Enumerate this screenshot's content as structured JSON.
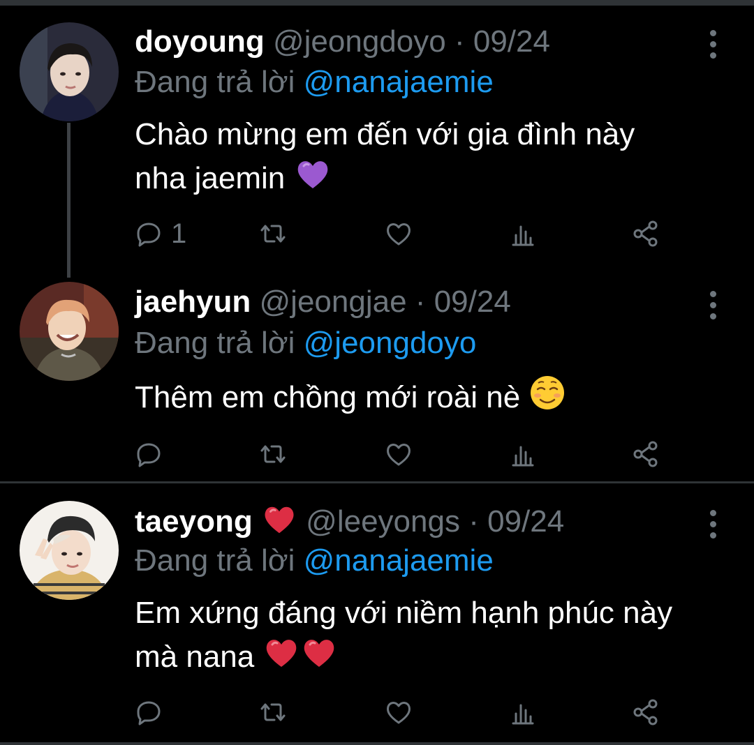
{
  "icons": {
    "reply": "reply-icon",
    "retweet": "retweet-icon",
    "like": "heart-icon",
    "analytics": "analytics-icon",
    "share": "share-icon",
    "more": "more-vertical-icon"
  },
  "colors": {
    "background": "#000000",
    "secondary_text": "#6e767d",
    "mention": "#1d9bf0",
    "divider": "#2f3336"
  },
  "tweets": [
    {
      "name": "doyoung",
      "handle": "@jeongdoyo",
      "separator": "·",
      "date": "09/24",
      "reply_label": "Đang trả lời",
      "reply_to": "@nanajaemie",
      "text_line1": "Chào mừng em đến với gia đình này",
      "text_line2": "nha jaemin",
      "emoji": "purple-heart",
      "reply_count": "1"
    },
    {
      "name": "jaehyun",
      "handle": "@jeongjae",
      "separator": "·",
      "date": "09/24",
      "reply_label": "Đang trả lời",
      "reply_to": "@jeongdoyo",
      "text_line1": "Thêm em chồng mới roài nè",
      "emoji": "smiling-face",
      "reply_count": ""
    },
    {
      "name": "taeyong",
      "name_emoji": "red-heart",
      "handle": "@leeyongs",
      "separator": "·",
      "date": "09/24",
      "reply_label": "Đang trả lời",
      "reply_to": "@nanajaemie",
      "text_line1": "Em xứng đáng với niềm hạnh phúc này",
      "text_line2": "mà nana",
      "emoji": "red-heart-x2",
      "reply_count": ""
    }
  ]
}
